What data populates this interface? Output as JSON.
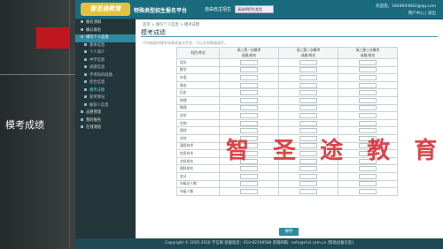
{
  "slide": {
    "caption": "模考成绩"
  },
  "header": {
    "logo_text": "智圣途教育",
    "site_title": "特殊类型招生报名平台",
    "site_subtitle": "自由自主招生",
    "select_value": "请选择招生类型",
    "user_info": "欢迎您，1844693842@qq.com",
    "user_links": "用户中心 | 退出"
  },
  "sidebar": {
    "items": [
      {
        "label": "报名须知",
        "sub": false,
        "active": false
      },
      {
        "label": "确认报名",
        "sub": false,
        "active": false
      },
      {
        "label": "填写个人信息",
        "sub": false,
        "active": true
      },
      {
        "label": "基本信息",
        "sub": true,
        "active": false
      },
      {
        "label": "个人简介",
        "sub": true,
        "active": false
      },
      {
        "label": "中学信息",
        "sub": true,
        "active": false
      },
      {
        "label": "成绩信息",
        "sub": true,
        "active": false
      },
      {
        "label": "学考科目成绩",
        "sub": true,
        "active": false
      },
      {
        "label": "综合信息",
        "sub": true,
        "active": false
      },
      {
        "label": "模考成绩",
        "sub": true,
        "active": true
      },
      {
        "label": "获奖情况",
        "sub": true,
        "active": false
      },
      {
        "label": "推荐人信息",
        "sub": true,
        "active": false
      },
      {
        "label": "志愿管理",
        "sub": false,
        "active": false
      },
      {
        "label": "我的报名",
        "sub": false,
        "active": false
      },
      {
        "label": "在线测验",
        "sub": false,
        "active": false
      }
    ]
  },
  "main": {
    "breadcrumb": "首页 > 填写个人信息 > 模考成绩",
    "title": "模考成绩",
    "hint": "不同维度的模考成绩或者文件里，可以没有数据填写。",
    "columns": [
      "科目/考试",
      "高三第一次模考\n成绩/排名",
      "高三第二次模考\n成绩/排名",
      "高三第三次模考\n成绩/排名"
    ],
    "subjects": [
      "语文",
      "数学",
      "外语",
      "政治",
      "历史",
      "地理",
      "物理",
      "化学",
      "生物",
      "理综",
      "文综",
      "通用技术",
      "信息技术",
      "文科排名",
      "理科排名",
      "总分",
      "年级总人数",
      "年级人数"
    ],
    "save_label": "保存"
  },
  "watermark": "智 圣 途 教 育",
  "footer": "Copyright © 2005-2016 学信网    客服电话：010-82199588    客服邮箱：kefu@chsi.com.cn    [帮助设备信息]"
}
